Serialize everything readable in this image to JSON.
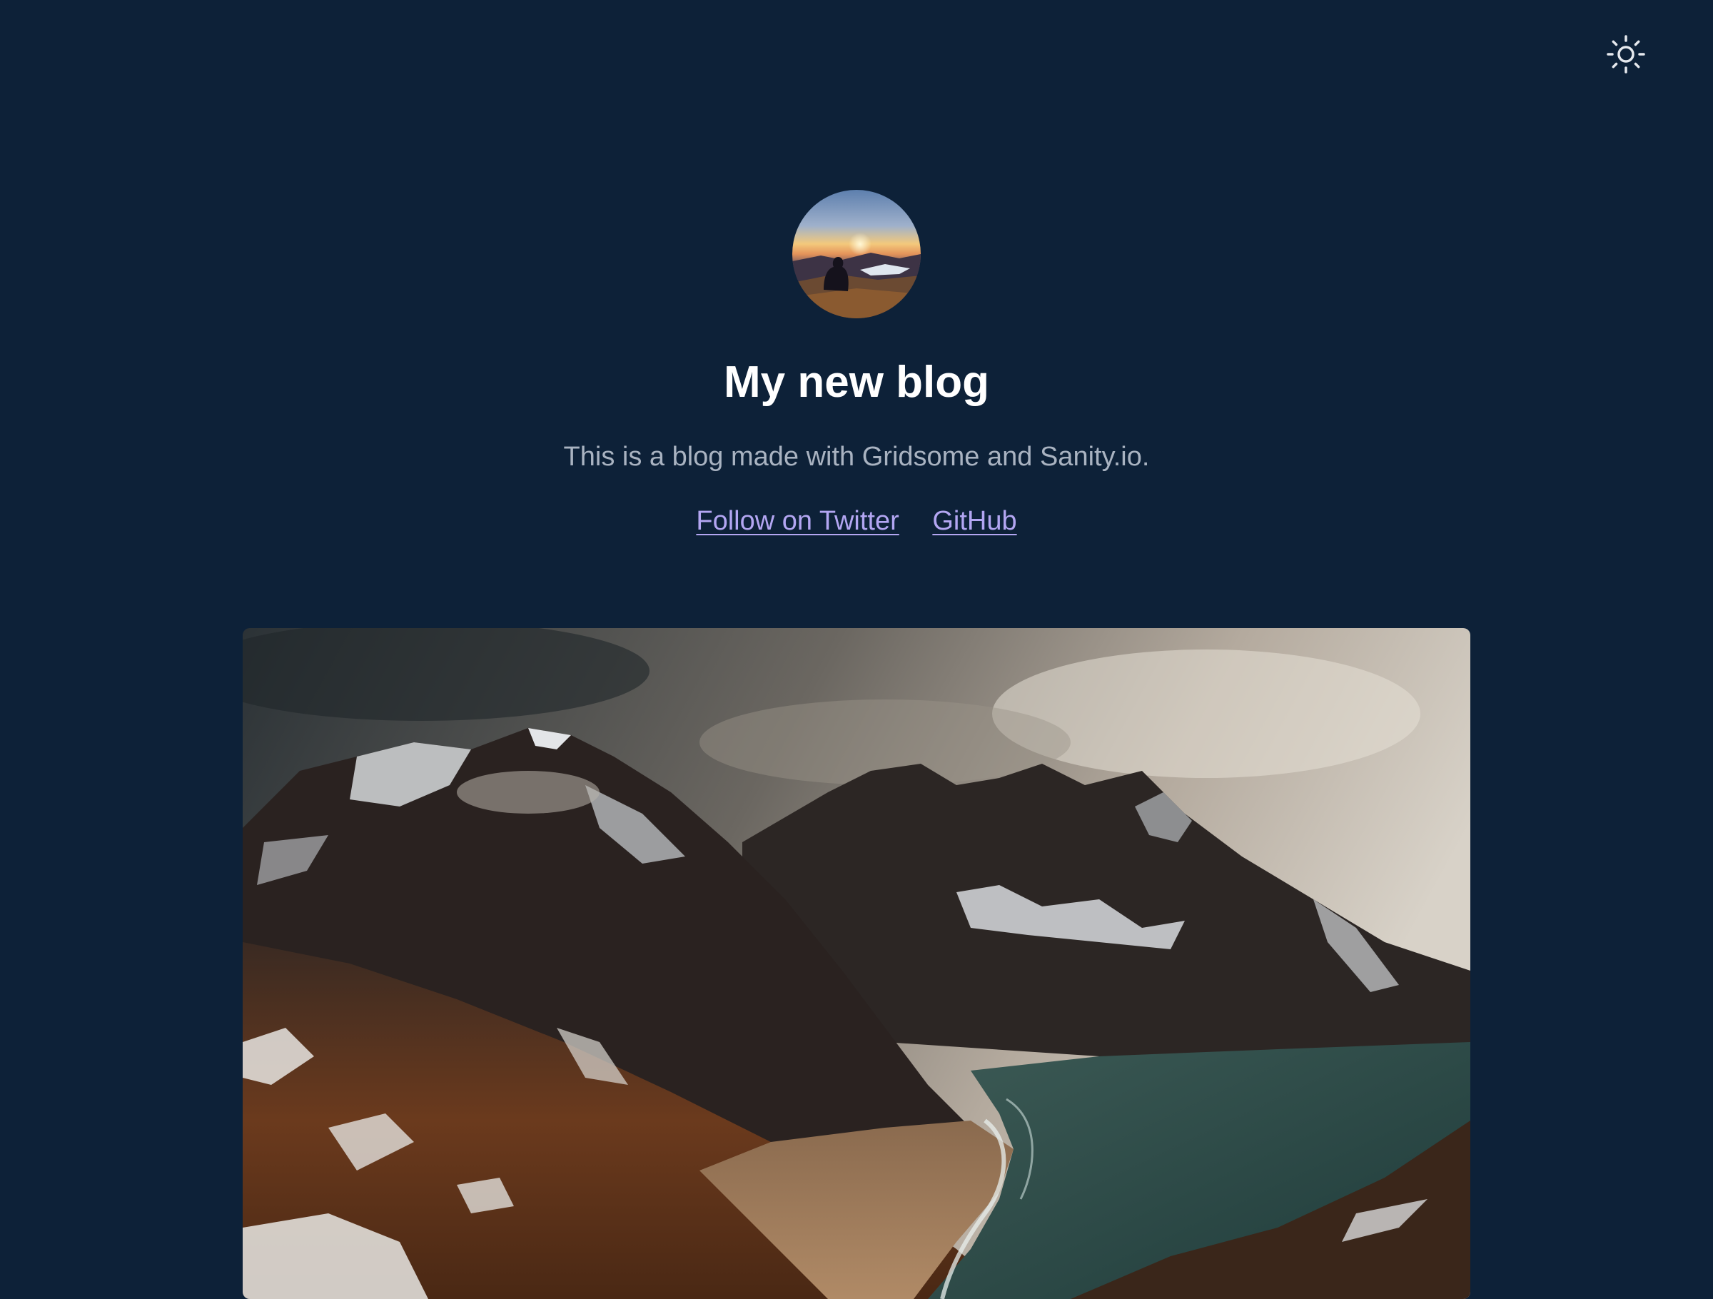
{
  "header": {
    "title": "My new blog",
    "description": "This is a blog made with Gridsome and Sanity.io.",
    "links": [
      {
        "label": "Follow on Twitter"
      },
      {
        "label": "GitHub"
      }
    ],
    "avatar_alt": "avatar"
  },
  "toolbar": {
    "theme_toggle_icon": "sun-icon"
  },
  "colors": {
    "background": "#0d2138",
    "title": "#ffffff",
    "description": "#a9b3c1",
    "link": "#b3a6f2"
  },
  "hero": {
    "image_alt": "featured post image"
  }
}
